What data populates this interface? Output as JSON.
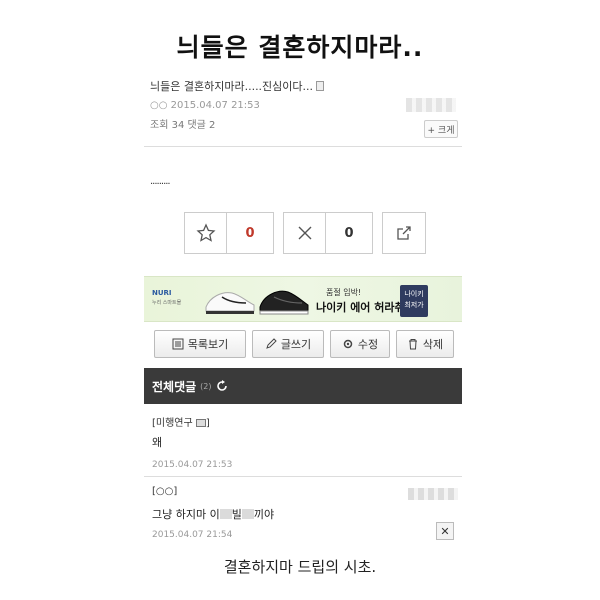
{
  "headline": "늬들은 결혼하지마라..",
  "post": {
    "title": "늬들은 결혼하지마라.....진심이다...",
    "meta": "○○ 2015.04.07 21:53",
    "stats": "조회 34  댓글 2",
    "zoom_label": "+ 크게",
    "body": "........."
  },
  "votes": {
    "recommend_count": "0",
    "oppose_count": "0"
  },
  "ad": {
    "brand": "NURI",
    "brand_sub": "누리 스마트몰",
    "sub_text": "품절 임박!",
    "main_text": "나이키 에어 허라취",
    "cta_line1": "나이키",
    "cta_line2": "최저가"
  },
  "actions": {
    "list": "목록보기",
    "write": "글쓰기",
    "edit": "수정",
    "delete": "삭제"
  },
  "comments_header": {
    "title": "전체댓글",
    "count": "(2)"
  },
  "comments": [
    {
      "author": "[미행연구",
      "body": "왜",
      "date": "2015.04.07 21:53"
    },
    {
      "author": "[○○]",
      "body_a": "그냥 하지마 이",
      "body_b": "빌",
      "body_c": "끼야",
      "date": "2015.04.07 21:54"
    }
  ],
  "caption": "결혼하지마 드립의 시초.",
  "colors": {
    "recommend": "#c0392b",
    "header_bg": "#3a3a3a",
    "ad_bg": "#eef7e4"
  }
}
